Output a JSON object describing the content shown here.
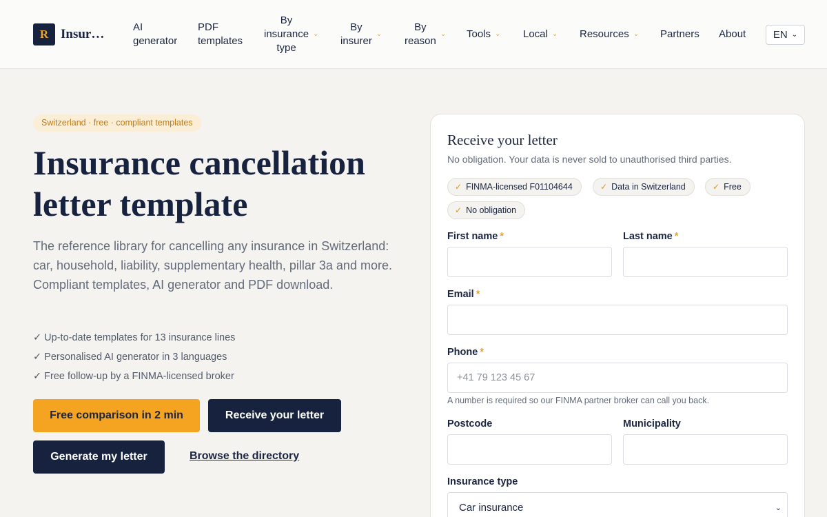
{
  "brand": {
    "mark": "R",
    "name": "Insurance"
  },
  "nav": {
    "items": [
      {
        "label": "AI\ngenerator",
        "has_dropdown": false
      },
      {
        "label": "PDF\ntemplates",
        "has_dropdown": false
      },
      {
        "label": "By\ninsurance\ntype",
        "has_dropdown": true
      },
      {
        "label": "By\ninsurer",
        "has_dropdown": true
      },
      {
        "label": "By\nreason",
        "has_dropdown": true
      },
      {
        "label": "Tools",
        "has_dropdown": true
      },
      {
        "label": "Local",
        "has_dropdown": true
      },
      {
        "label": "Resources",
        "has_dropdown": true
      },
      {
        "label": "Partners",
        "has_dropdown": false
      },
      {
        "label": "About",
        "has_dropdown": false
      }
    ],
    "language": "EN"
  },
  "hero": {
    "tag": "Switzerland · free · compliant templates",
    "title": "Insurance cancellation letter template",
    "description": "The reference library for cancelling any insurance in Switzerland: car, household, liability, supplementary health, pillar 3a and more. Compliant templates, AI generator and PDF download.",
    "checks": [
      "✓ Up-to-date templates for 13 insurance lines",
      "✓ Personalised AI generator in 3 languages",
      "✓ Free follow-up by a FINMA-licensed broker"
    ],
    "cta_primary": "Free comparison in 2 min",
    "cta_receive": "Receive your letter",
    "cta_generate": "Generate my letter",
    "link_directory": "Browse the directory"
  },
  "form": {
    "title": "Receive your letter",
    "subtitle": "No obligation. Your data is never sold to unauthorised third parties.",
    "chips": [
      "FINMA-licensed F01104644",
      "Data in Switzerland",
      "Free",
      "No obligation"
    ],
    "first_name_label": "First name",
    "last_name_label": "Last name",
    "email_label": "Email",
    "phone_label": "Phone",
    "phone_placeholder": "+41 79 123 45 67",
    "phone_hint": "A number is required so our FINMA partner broker can call you back.",
    "postcode_label": "Postcode",
    "municipality_label": "Municipality",
    "insurance_type_label": "Insurance type",
    "insurance_type_value": "Car insurance",
    "required_mark": "*"
  },
  "colors": {
    "accent": "#f5a421",
    "navy": "#17223f",
    "background": "#f4f3f0"
  }
}
